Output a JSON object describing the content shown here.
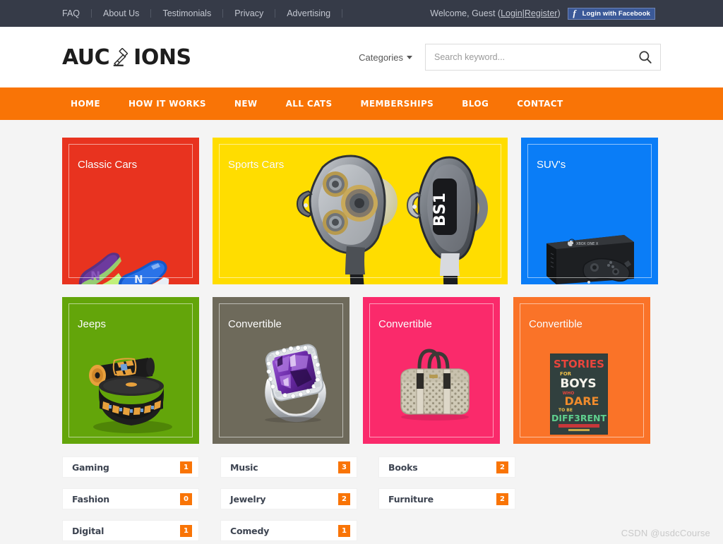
{
  "topbar": {
    "links": [
      {
        "label": "FAQ"
      },
      {
        "label": "About Us"
      },
      {
        "label": "Testimonials"
      },
      {
        "label": "Privacy"
      },
      {
        "label": "Advertising"
      }
    ],
    "welcome_prefix": "Welcome, Guest ( ",
    "login_label": "Login",
    "separator": " | ",
    "register_label": "Register",
    "welcome_suffix": " )",
    "facebook_button_label": "Login with Facebook",
    "facebook_icon": "facebook-f-icon",
    "background_color": "#363b48",
    "facebook_color": "#3b5998"
  },
  "header": {
    "logo_prefix": "AUC",
    "logo_suffix": "IONS",
    "logo_icon": "gavel-icon",
    "categories_label": "Categories",
    "search": {
      "placeholder": "Search keyword...",
      "value": "",
      "icon": "search-icon"
    }
  },
  "nav": {
    "items": [
      {
        "label": "HOME"
      },
      {
        "label": "HOW IT WORKS"
      },
      {
        "label": "NEW"
      },
      {
        "label": "ALL CATS"
      },
      {
        "label": "MEMBERSHIPS"
      },
      {
        "label": "BLOG"
      },
      {
        "label": "CONTACT"
      }
    ],
    "background_color": "#f97406"
  },
  "tiles": {
    "row1": [
      {
        "title": "Classic Cars",
        "color": "#e8331f",
        "size": "w1",
        "art": "sneakers"
      },
      {
        "title": "Sports Cars",
        "color": "#ffdd00",
        "size": "w2",
        "art": "earbuds",
        "art_label": "BS1"
      },
      {
        "title": "SUV's",
        "color": "#0a7df7",
        "size": "w1",
        "art": "console",
        "art_label": "XBOX ONE X"
      }
    ],
    "row2": [
      {
        "title": "Jeeps",
        "color": "#63a50a",
        "size": "w1",
        "art": "chair"
      },
      {
        "title": "Convertible",
        "color": "#6e6a5b",
        "size": "w1",
        "art": "ring"
      },
      {
        "title": "Convertible",
        "color": "#fa2a6b",
        "size": "w1",
        "art": "bag"
      },
      {
        "title": "Convertible",
        "color": "#fa7328",
        "size": "w1",
        "art": "book"
      }
    ]
  },
  "categories": [
    {
      "label": "Gaming",
      "count": "1"
    },
    {
      "label": "Music",
      "count": "3"
    },
    {
      "label": "Books",
      "count": "2"
    },
    {
      "label": "Fashion",
      "count": "0"
    },
    {
      "label": "Jewelry",
      "count": "2"
    },
    {
      "label": "Furniture",
      "count": "2"
    },
    {
      "label": "Digital",
      "count": "1"
    },
    {
      "label": "Comedy",
      "count": "1"
    }
  ],
  "watermark": "CSDN @usdcCourse",
  "book_art": {
    "line1": "STORIES",
    "line2": "FOR",
    "line3": "BOYS",
    "line4": "WHO",
    "line5": "DARE",
    "line6": "TO BE",
    "line7": "DIFF3RENT"
  }
}
